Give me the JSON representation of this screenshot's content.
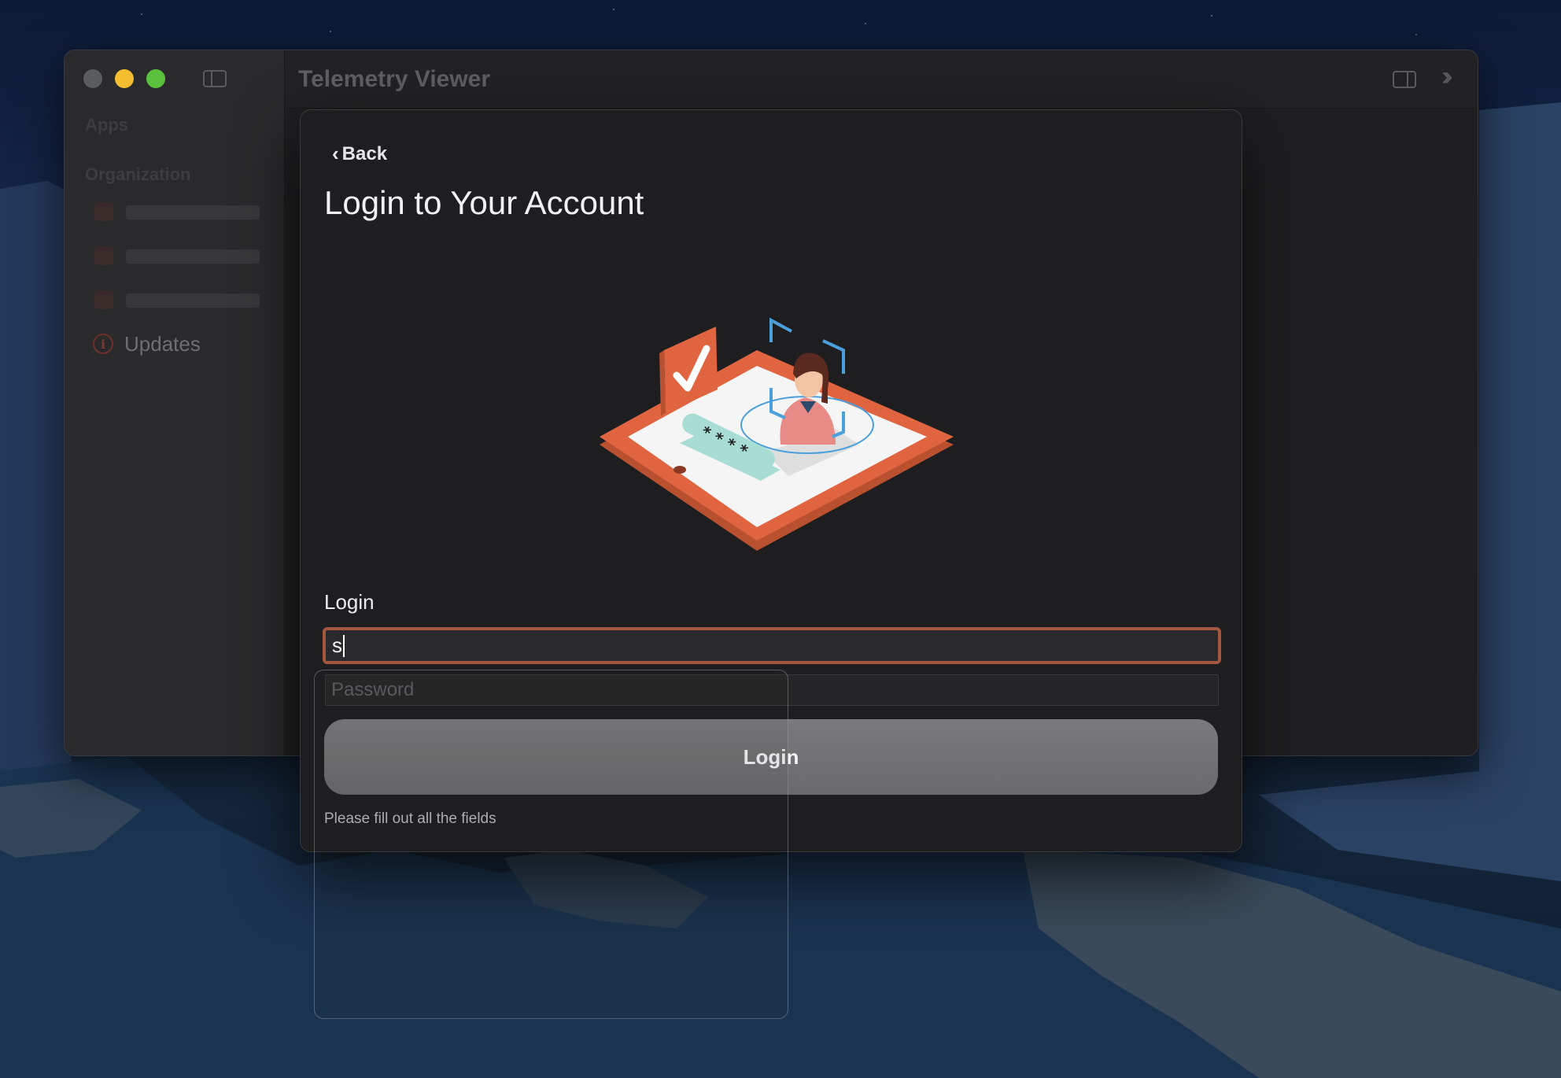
{
  "window": {
    "title": "Telemetry Viewer"
  },
  "sidebar": {
    "section_apps": "Apps",
    "section_organization": "Organization",
    "items": [
      {
        "label": "Updates",
        "icon": "info-circle-icon"
      }
    ]
  },
  "sheet": {
    "back_label": "Back",
    "title": "Login to Your Account",
    "login_label": "Login",
    "login_value": "s",
    "password_placeholder": "Password",
    "login_button": "Login",
    "hint": "Please fill out all the fields"
  },
  "colors": {
    "accent": "#a4573f",
    "illustration_orange": "#e0643f",
    "illustration_teal": "#a8ddd4",
    "illustration_blue": "#4a9fdc"
  }
}
